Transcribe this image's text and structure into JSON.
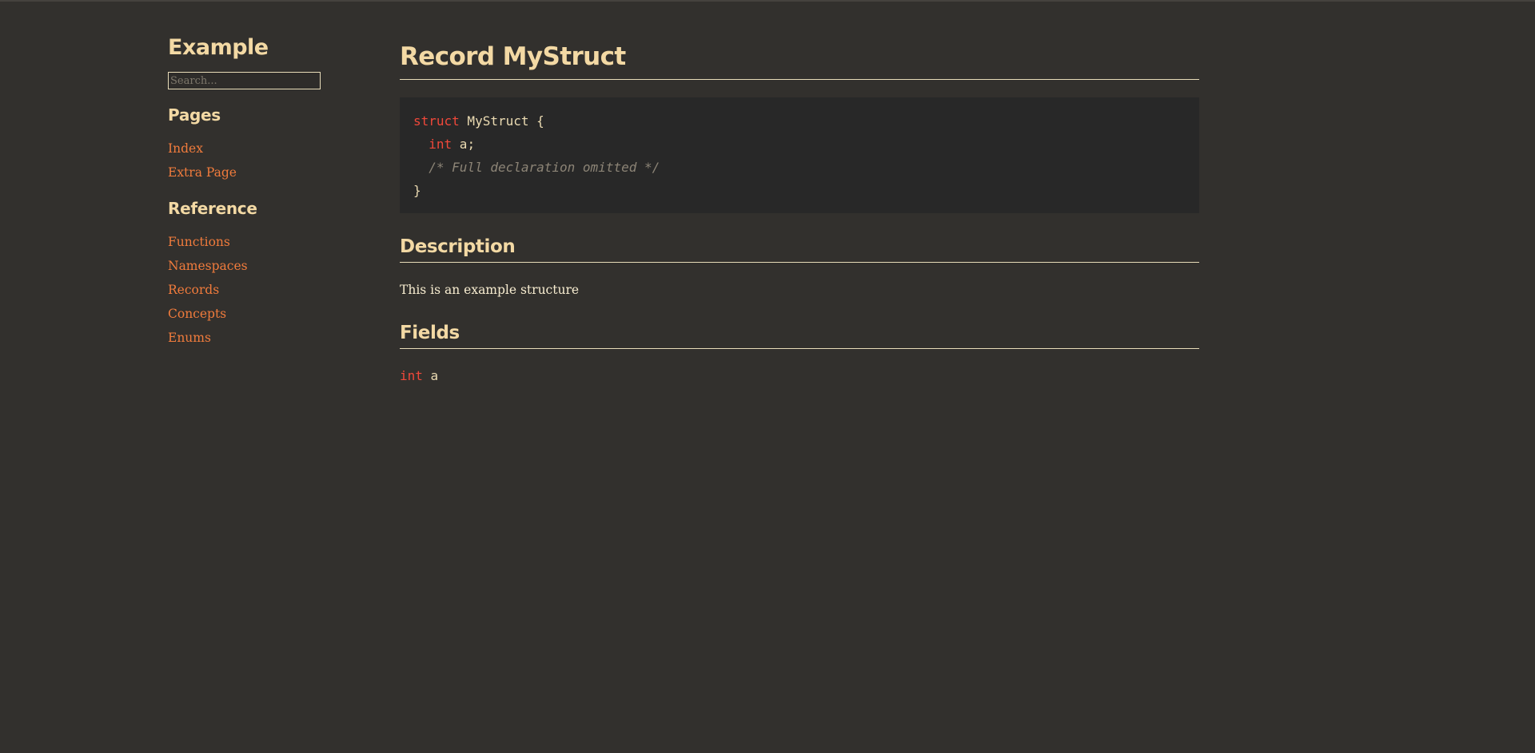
{
  "sidebar": {
    "site_title": "Example",
    "search_placeholder": "Search...",
    "pages_heading": "Pages",
    "pages": [
      {
        "label": "Index"
      },
      {
        "label": "Extra Page"
      }
    ],
    "reference_heading": "Reference",
    "reference": [
      {
        "label": "Functions"
      },
      {
        "label": "Namespaces"
      },
      {
        "label": "Records"
      },
      {
        "label": "Concepts"
      },
      {
        "label": "Enums"
      }
    ]
  },
  "main": {
    "title": "Record MyStruct",
    "code": {
      "line1_keyword": "struct",
      "line1_rest": " MyStruct {",
      "line2_indent": "  ",
      "line2_keyword": "int",
      "line2_rest": " a;",
      "line3_indent": "  ",
      "line3_comment": "/* Full declaration omitted */",
      "line4": "}"
    },
    "description_heading": "Description",
    "description_text": "This is an example structure",
    "fields_heading": "Fields",
    "fields": [
      {
        "type": "int",
        "name": " a"
      }
    ]
  },
  "colors": {
    "background": "#32302d",
    "code_background": "#282828",
    "heading": "#f3d9a4",
    "link": "#f07b3c",
    "keyword": "#f0483a",
    "comment": "#8c8476"
  }
}
